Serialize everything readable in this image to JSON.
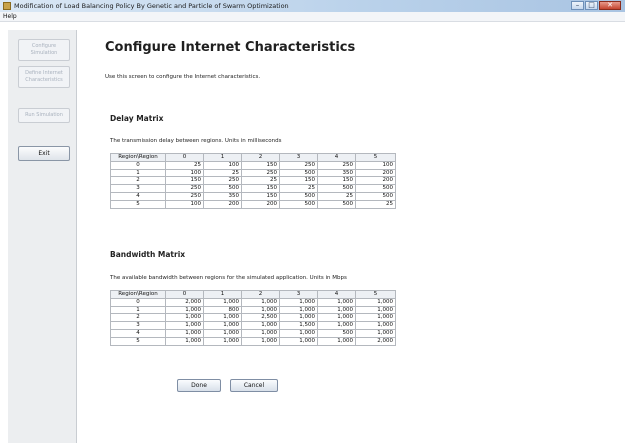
{
  "window": {
    "title": "Modification of Load Balancing Policy By Genetic and Particle of Swarm Optimization",
    "controls": [
      "–",
      "□",
      "✕"
    ]
  },
  "menubar": {
    "items": [
      "Help"
    ]
  },
  "sidebar": {
    "configure_simulation": "Configure Simulation",
    "define_internet": "Define Internet Characteristics",
    "run_simulation": "Run Simulation",
    "exit": "Exit"
  },
  "main": {
    "title": "Configure Internet Characteristics",
    "intro": "Use this screen to configure the Internet characteristics."
  },
  "delay": {
    "title": "Delay Matrix",
    "description": "The transmission delay between regions. Units in milliseconds",
    "corner": "Region\\Region",
    "columns": [
      "0",
      "1",
      "2",
      "3",
      "4",
      "5"
    ],
    "rows": [
      {
        "label": "0",
        "values": [
          "25",
          "100",
          "150",
          "250",
          "250",
          "100"
        ]
      },
      {
        "label": "1",
        "values": [
          "100",
          "25",
          "250",
          "500",
          "350",
          "200"
        ]
      },
      {
        "label": "2",
        "values": [
          "150",
          "250",
          "25",
          "150",
          "150",
          "200"
        ]
      },
      {
        "label": "3",
        "values": [
          "250",
          "500",
          "150",
          "25",
          "500",
          "500"
        ]
      },
      {
        "label": "4",
        "values": [
          "250",
          "350",
          "150",
          "500",
          "25",
          "500"
        ]
      },
      {
        "label": "5",
        "values": [
          "100",
          "200",
          "200",
          "500",
          "500",
          "25"
        ]
      }
    ]
  },
  "bandwidth": {
    "title": "Bandwidth Matrix",
    "description": "The available bandwidth between regions for the simulated application. Units in Mbps",
    "corner": "Region\\Region",
    "columns": [
      "0",
      "1",
      "2",
      "3",
      "4",
      "5"
    ],
    "rows": [
      {
        "label": "0",
        "values": [
          "2,000",
          "1,000",
          "1,000",
          "1,000",
          "1,000",
          "1,000"
        ]
      },
      {
        "label": "1",
        "values": [
          "1,000",
          "800",
          "1,000",
          "1,000",
          "1,000",
          "1,000"
        ]
      },
      {
        "label": "2",
        "values": [
          "1,000",
          "1,000",
          "2,500",
          "1,000",
          "1,000",
          "1,000"
        ]
      },
      {
        "label": "3",
        "values": [
          "1,000",
          "1,000",
          "1,000",
          "1,500",
          "1,000",
          "1,000"
        ]
      },
      {
        "label": "4",
        "values": [
          "1,000",
          "1,000",
          "1,000",
          "1,000",
          "500",
          "1,000"
        ]
      },
      {
        "label": "5",
        "values": [
          "1,000",
          "1,000",
          "1,000",
          "1,000",
          "1,000",
          "2,000"
        ]
      }
    ]
  },
  "actions": {
    "done": "Done",
    "cancel": "Cancel"
  }
}
